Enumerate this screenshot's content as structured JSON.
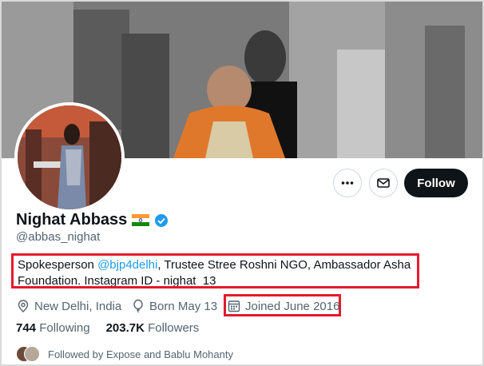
{
  "profile": {
    "name": "Nighat Abbass",
    "flag_emoji": "🇮🇳",
    "handle": "@abbas_nighat",
    "bio": {
      "part1": "Spokesperson ",
      "mention": "@bjp4delhi",
      "part2": ", Trustee Stree Roshni NGO, Ambassador Asha Foundation. Instagram ID - nighat_13"
    },
    "location": "New Delhi, India",
    "birthday": "Born May 13",
    "joined": "Joined June 2016",
    "following_count": "744",
    "following_label": "Following",
    "followers_count": "203.7K",
    "followers_label": "Followers",
    "followed_by": "Followed by Expose and Bablu Mohanty"
  },
  "actions": {
    "more_icon": "more-dots-icon",
    "message_icon": "mail-icon",
    "follow_label": "Follow"
  },
  "colors": {
    "accent": "#1d9bf0",
    "follow_button_bg": "#0f1419",
    "highlight_border": "#e5192c",
    "secondary_text": "#536471"
  }
}
